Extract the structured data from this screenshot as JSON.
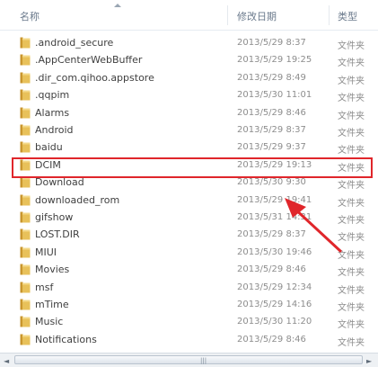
{
  "header": {
    "name_label": "名称",
    "date_label": "修改日期",
    "type_label": "类型"
  },
  "files": [
    {
      "name": ".android_secure",
      "date": "2013/5/29 8:37",
      "type": "文件夹"
    },
    {
      "name": ".AppCenterWebBuffer",
      "date": "2013/5/29 19:25",
      "type": "文件夹"
    },
    {
      "name": ".dir_com.qihoo.appstore",
      "date": "2013/5/29 8:49",
      "type": "文件夹"
    },
    {
      "name": ".qqpim",
      "date": "2013/5/30 11:01",
      "type": "文件夹"
    },
    {
      "name": "Alarms",
      "date": "2013/5/29 8:46",
      "type": "文件夹"
    },
    {
      "name": "Android",
      "date": "2013/5/29 8:37",
      "type": "文件夹"
    },
    {
      "name": "baidu",
      "date": "2013/5/29 9:37",
      "type": "文件夹"
    },
    {
      "name": "DCIM",
      "date": "2013/5/29 19:13",
      "type": "文件夹"
    },
    {
      "name": "Download",
      "date": "2013/5/30 9:30",
      "type": "文件夹"
    },
    {
      "name": "downloaded_rom",
      "date": "2013/5/29 19:41",
      "type": "文件夹"
    },
    {
      "name": "gifshow",
      "date": "2013/5/31 14:31",
      "type": "文件夹"
    },
    {
      "name": "LOST.DIR",
      "date": "2013/5/29 8:37",
      "type": "文件夹"
    },
    {
      "name": "MIUI",
      "date": "2013/5/30 19:46",
      "type": "文件夹"
    },
    {
      "name": "Movies",
      "date": "2013/5/29 8:46",
      "type": "文件夹"
    },
    {
      "name": "msf",
      "date": "2013/5/29 12:34",
      "type": "文件夹"
    },
    {
      "name": "mTime",
      "date": "2013/5/29 14:16",
      "type": "文件夹"
    },
    {
      "name": "Music",
      "date": "2013/5/30 11:20",
      "type": "文件夹"
    },
    {
      "name": "Notifications",
      "date": "2013/5/29 8:46",
      "type": "文件夹"
    }
  ],
  "highlighted": "DCIM",
  "icons": {
    "folder": "folder-icon",
    "sort": "sort-ascending-icon"
  },
  "colors": {
    "highlight": "#e0262b",
    "folder": "#e8c15a"
  },
  "scrollbar": {
    "left_glyph": "◄",
    "right_glyph": "►",
    "grip_glyph": "|||"
  }
}
